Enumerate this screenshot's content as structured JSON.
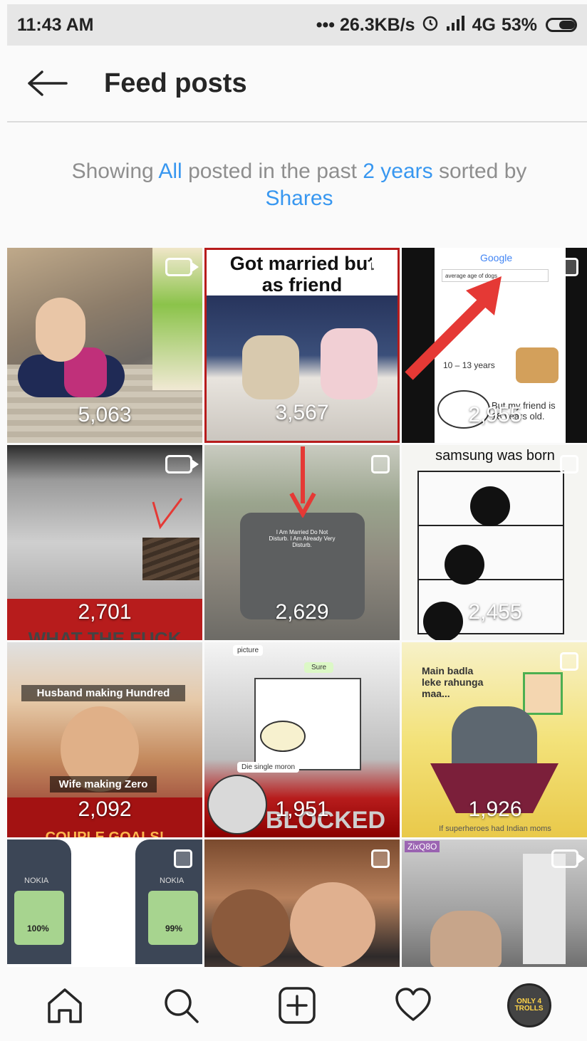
{
  "status_bar": {
    "time": "11:43 AM",
    "speed": "••• 26.3KB/s",
    "network": "4G",
    "battery": "53%",
    "icons": [
      "alarm-icon",
      "signal-icon",
      "battery-icon"
    ]
  },
  "header": {
    "title": "Feed posts",
    "back_icon": "arrow-left-icon"
  },
  "summary": {
    "prefix": "Showing",
    "filter_type": "All",
    "middle": "posted in the past",
    "period": "2 years",
    "suffix": "sorted by",
    "sort": "Shares"
  },
  "posts": [
    {
      "count": "5,063",
      "type": "video"
    },
    {
      "count": "3,567",
      "type": "carousel",
      "caption": "Got married but as friend"
    },
    {
      "count": "2,955",
      "type": "carousel",
      "search_text": "average age of dogs",
      "result": "10 – 13 years",
      "overlay": "But my friend is 18 years old.",
      "logo": "Google"
    },
    {
      "count": "2,701",
      "type": "video",
      "banner": "WHAT THE FUCK"
    },
    {
      "count": "2,629",
      "type": "carousel",
      "sticker": "I Am Married Do Not Disturb. I Am Already Very Disturb."
    },
    {
      "count": "2,455",
      "type": "carousel",
      "caption": "samsung was born"
    },
    {
      "count": "2,092",
      "type": "image",
      "top": "Husband making Hundred",
      "bottom": "Wife making Zero",
      "banner": "COUPLE GOALS!"
    },
    {
      "count": "1,951",
      "type": "image",
      "chat1": "picture",
      "chat2": "Sure",
      "chat3": "Die single moron",
      "banner": "BLOCKED"
    },
    {
      "count": "1,926",
      "type": "carousel",
      "caption": "Main badla leke rahunga maa...",
      "footer": "If superheroes had Indian moms"
    },
    {
      "count": "",
      "type": "carousel",
      "brand": "NOKIA",
      "left_pct": "100%",
      "right_pct": "99%"
    },
    {
      "count": "",
      "type": "carousel"
    },
    {
      "count": "",
      "type": "video",
      "tag": "ZixQ8O"
    }
  ],
  "tab_bar": {
    "items": [
      "home-icon",
      "search-icon",
      "new-post-icon",
      "activity-heart-icon",
      "profile-avatar"
    ],
    "avatar_text": "ONLY 4 TROLLS"
  }
}
